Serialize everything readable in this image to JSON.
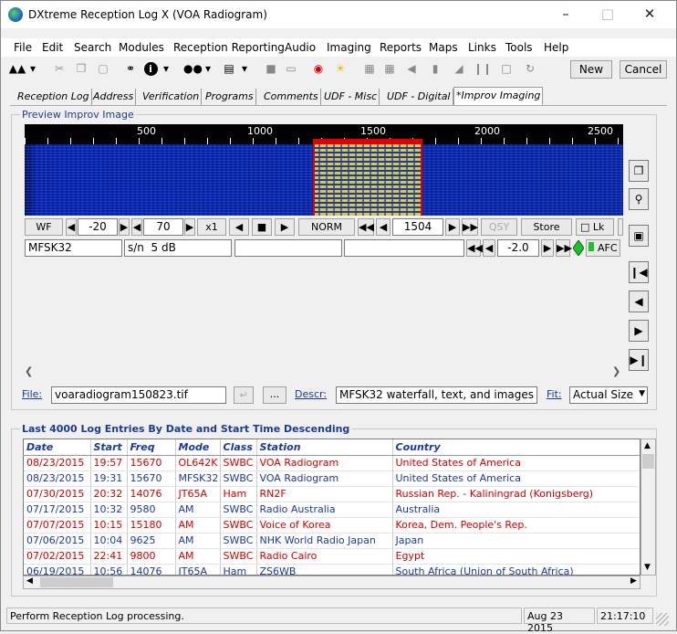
{
  "window": {
    "title": "DXtreme Reception Log X (VOA Radiogram)"
  },
  "menu": [
    "File",
    "Edit",
    "Search",
    "Modules",
    "Reception Reporting",
    "Audio",
    "Imaging",
    "Reports",
    "Maps",
    "Links",
    "Tools",
    "Help"
  ],
  "toolbar": {
    "new_label": "New",
    "cancel_label": "Cancel"
  },
  "tabs": [
    "Reception Log",
    "Address",
    "Verification",
    "Programs",
    "Comments",
    "UDF - Misc",
    "UDF - Digital",
    "*Improv Imaging"
  ],
  "preview": {
    "group_label": "Preview Improv Image",
    "scale": [
      "500",
      "1000",
      "1500",
      "2000",
      "2500"
    ],
    "controls": {
      "wf": "WF",
      "gain": "-20",
      "range": "70",
      "zoom": "x1",
      "norm": "NORM",
      "freq": "1504",
      "qsy": "QSY",
      "store": "Store",
      "lk": "Lk"
    },
    "mode": "MFSK32",
    "sn_label": "s/n",
    "sn_value": "5 dB",
    "offset": "-2.0",
    "afc": "AFC"
  },
  "file_row": {
    "file_label": "File:",
    "file_value": "voaradiogram150823.tif",
    "browse": "...",
    "descr_label": "Descr:",
    "descr_value": "MFSK32 waterfall, text, and images",
    "fit_label": "Fit:",
    "fit_value": "Actual Size"
  },
  "log": {
    "group_label": "Last 4000 Log Entries By Date and Start Time Descending",
    "columns": [
      "Date",
      "Start",
      "Freq",
      "Mode",
      "Class",
      "Station",
      "Country"
    ],
    "rows": [
      {
        "c": "red",
        "v": [
          "08/23/2015",
          "19:57",
          "15670",
          "OL642K",
          "SWBC",
          "VOA Radiogram",
          "United States of America"
        ]
      },
      {
        "c": "blue",
        "v": [
          "08/23/2015",
          "19:31",
          "15670",
          "MFSK32",
          "SWBC",
          "VOA Radiogram",
          "United States of America"
        ]
      },
      {
        "c": "red",
        "v": [
          "07/30/2015",
          "20:32",
          "14076",
          "JT65A",
          "Ham",
          "RN2F",
          "Russian Rep. - Kaliningrad (Konigsberg)"
        ]
      },
      {
        "c": "blue",
        "v": [
          "07/17/2015",
          "10:32",
          "9580",
          "AM",
          "SWBC",
          "Radio Australia",
          "Australia"
        ]
      },
      {
        "c": "red",
        "v": [
          "07/07/2015",
          "10:15",
          "15180",
          "AM",
          "SWBC",
          "Voice of Korea",
          "Korea, Dem. People's Rep."
        ]
      },
      {
        "c": "blue",
        "v": [
          "07/06/2015",
          "10:04",
          "9625",
          "AM",
          "SWBC",
          "NHK World Radio Japan",
          "Japan"
        ]
      },
      {
        "c": "red",
        "v": [
          "07/02/2015",
          "22:41",
          "9800",
          "AM",
          "SWBC",
          "Radio Cairo",
          "Egypt"
        ]
      },
      {
        "c": "blue",
        "v": [
          "06/19/2015",
          "10:56",
          "14076",
          "JT65A",
          "Ham",
          "ZS6WB",
          "South Africa (Union of South Africa)"
        ]
      }
    ]
  },
  "status": {
    "message": "Perform Reception Log processing.",
    "date": "Aug 23 2015",
    "time": "21:17:10"
  }
}
